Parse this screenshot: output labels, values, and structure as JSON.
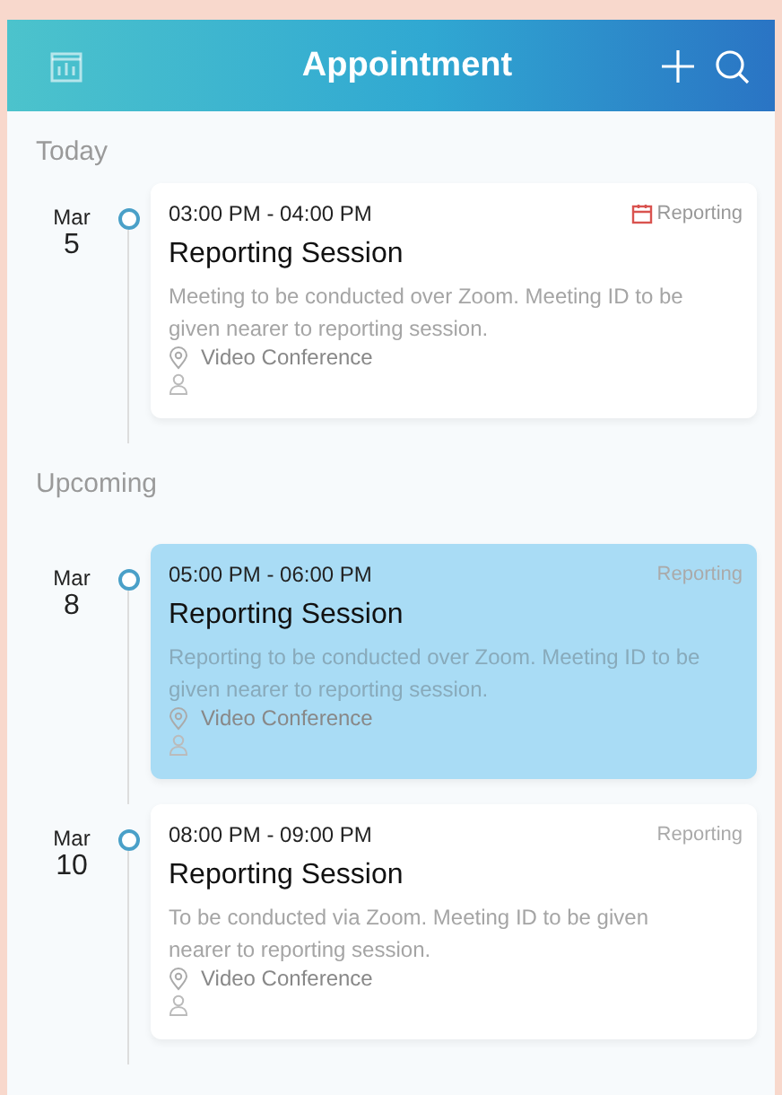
{
  "header": {
    "title": "Appointment"
  },
  "sections": [
    {
      "title": "Today",
      "appointments": [
        {
          "month": "Mar",
          "day": "5",
          "time": "03:00 PM - 04:00 PM",
          "tag": "Reporting",
          "tag_flagged": true,
          "title": "Reporting Session",
          "description": "Meeting to be conducted over Zoom. Meeting ID to be given nearer to reporting session.",
          "location": "Video Conference",
          "selected": false
        }
      ]
    },
    {
      "title": "Upcoming",
      "appointments": [
        {
          "month": "Mar",
          "day": "8",
          "time": "05:00 PM - 06:00 PM",
          "tag": "Reporting",
          "tag_flagged": false,
          "title": "Reporting Session",
          "description": "Reporting to be conducted over Zoom. Meeting ID to be given nearer to reporting session.",
          "location": "Video Conference",
          "selected": true
        },
        {
          "month": "Mar",
          "day": "10",
          "time": "08:00 PM - 09:00 PM",
          "tag": "Reporting",
          "tag_flagged": false,
          "title": "Reporting Session",
          "description": "To be conducted via Zoom. Meeting ID to be given nearer to reporting session.",
          "location": "Video Conference",
          "selected": false
        }
      ]
    }
  ]
}
